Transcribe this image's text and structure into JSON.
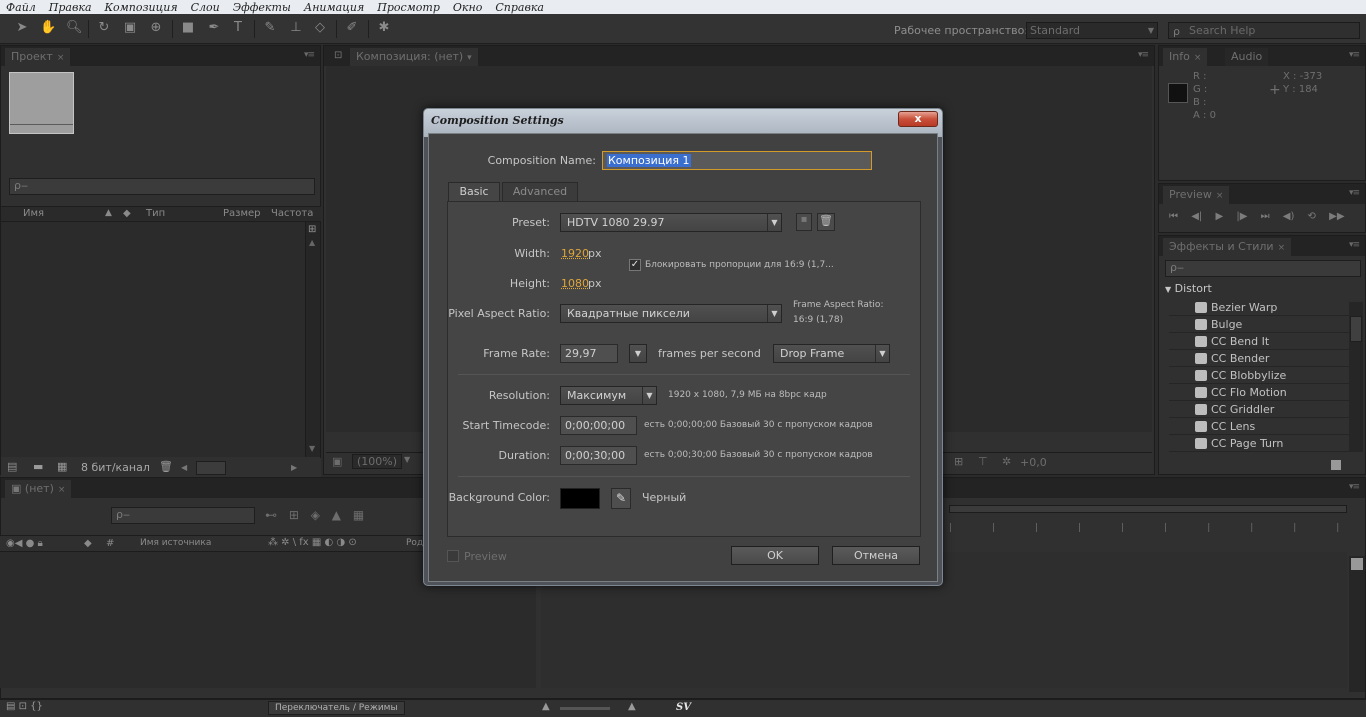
{
  "menu": [
    "Файл",
    "Правка",
    "Композиция",
    "Слои",
    "Эффекты",
    "Анимация",
    "Просмотр",
    "Окно",
    "Справка"
  ],
  "toolbar": {
    "workspace_label": "Рабочее пространство:",
    "workspace_value": "Standard",
    "search_placeholder": "Search Help"
  },
  "project_panel": {
    "tab": "Проект",
    "search_placeholder": "ρ‒",
    "columns": [
      "Имя",
      "Тип",
      "Размер",
      "Частота ..."
    ],
    "bit_depth": "8 бит/канал"
  },
  "composition_panel": {
    "tab": "Композиция: (нет)",
    "zoom": "(100%)",
    "exposure": "+0,0"
  },
  "info_panel": {
    "tabs": [
      "Info",
      "Audio"
    ],
    "channels": [
      "R :",
      "G :",
      "B :",
      "A : 0"
    ],
    "x": "X : -373",
    "y": "Y : 184"
  },
  "preview_panel": {
    "tab": "Preview"
  },
  "effects_panel": {
    "tab": "Эффекты и Стили",
    "category": "Distort",
    "items": [
      "Bezier Warp",
      "Bulge",
      "CC Bend It",
      "CC Bender",
      "CC Blobbylize",
      "CC Flo Motion",
      "CC Griddler",
      "CC Lens",
      "CC Page Turn"
    ]
  },
  "timeline": {
    "tab": "(нет)",
    "source_name_header": "Имя источника",
    "parent_header": "Род",
    "switches_button": "Переключатель / Режимы",
    "footer_sv": "SV"
  },
  "dialog": {
    "title": "Composition Settings",
    "close_label": "x",
    "comp_name_label": "Composition Name:",
    "comp_name_value": "Композиция 1",
    "tabs": [
      "Basic",
      "Advanced"
    ],
    "preset_label": "Preset:",
    "preset_value": "HDTV 1080 29.97",
    "width_label": "Width:",
    "width_value": "1920",
    "height_label": "Height:",
    "height_value": "1080",
    "px": "px",
    "lock_label": "Блокировать пропорции для 16:9 (1,7...",
    "par_label": "Pixel Aspect Ratio:",
    "par_value": "Квадратные пиксели",
    "far_label": "Frame Aspect Ratio:",
    "far_value": "16:9 (1,78)",
    "framerate_label": "Frame Rate:",
    "framerate_value": "29,97",
    "fps_label": "frames per second",
    "drop_frame_value": "Drop Frame",
    "resolution_label": "Resolution:",
    "resolution_value": "Максимум",
    "resolution_info": "1920 x 1080, 7,9 МБ на 8bpc кадр",
    "start_tc_label": "Start Timecode:",
    "start_tc_value": "0;00;00;00",
    "start_tc_info": "есть 0;00;00;00  Базовый 30 с пропуском кадров",
    "duration_label": "Duration:",
    "duration_value": "0;00;30;00",
    "duration_info": "есть 0;00;30;00  Базовый 30 с пропуском кадров",
    "bg_label": "Background Color:",
    "bg_name": "Черный",
    "bg_color": "#000000",
    "preview_label": "Preview",
    "ok_label": "OK",
    "cancel_label": "Отмена"
  },
  "colors": {
    "accent_link": "#e0a63a",
    "close_button": "#c9503a",
    "selection": "#3a6fcf"
  }
}
